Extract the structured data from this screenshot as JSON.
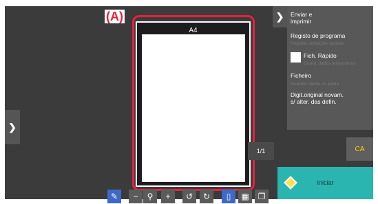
{
  "callout_label": "(A)",
  "preview": {
    "paper_size": "A4",
    "page_counter": "1/1"
  },
  "menu": {
    "send_and_print": "Enviar e\nimprimir",
    "program_register": "Registo de programa",
    "program_register_sub": "Registar definições actuais",
    "quick_file": "Fich. Rápido",
    "quick_file_sub": "Guard. dados temporários",
    "file": "Ficheiro",
    "file_sub": "Guardar dados na pasta",
    "scan_new_original": "Digit.original novam.\ns/ alter. das defin."
  },
  "buttons": {
    "ca": "CA",
    "start": "Iniciar"
  },
  "icons": {
    "left_expand": "chevron-right-icon",
    "side_expand": "chevron-right-icon",
    "toolbar": [
      "edit-icon",
      "zoom-out-icon",
      "zoom-icon",
      "zoom-in-icon",
      "rotate-left-icon",
      "rotate-right-icon",
      "single-page-icon",
      "thumbnails-icon",
      "multi-page-icon"
    ]
  },
  "colors": {
    "callout": "#e8203f",
    "start_button": "#2bb5b0",
    "ca_text": "#ffd400",
    "panel": "#585858",
    "screen": "#3b3b3b"
  }
}
